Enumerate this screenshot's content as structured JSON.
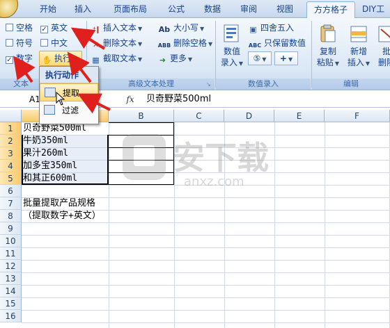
{
  "tabs": [
    "开始",
    "插入",
    "页面布局",
    "公式",
    "数据",
    "审阅",
    "视图",
    "方方格子",
    "DIY工"
  ],
  "active_tab": "方方格子",
  "ribbon": {
    "text_group": {
      "checkboxes": [
        {
          "label": "空格",
          "checked": false
        },
        {
          "label": "英文",
          "checked": true
        },
        {
          "label": "符号",
          "checked": false
        },
        {
          "label": "中文",
          "checked": false
        },
        {
          "label": "数字",
          "checked": true
        }
      ],
      "exec_label": "执行",
      "group_label": "文本"
    },
    "advanced_group": {
      "items": [
        "插入文本",
        "删除文本",
        "截取文本"
      ],
      "right_items": [
        "大小写",
        "删除空格",
        "更多"
      ],
      "group_label": "高级文本处理",
      "icons": {
        "caps": "Ab",
        "space": "ABB"
      }
    },
    "number_group": {
      "buttons": [
        "数值录入",
        "四舍五入",
        "只保留数值"
      ],
      "big_label_line1": "数值",
      "big_label_line2": "录入",
      "group_label": "数值录入",
      "plus": "+"
    },
    "edit_group": {
      "buttons": [
        {
          "line1": "复制",
          "line2": "粘贴"
        },
        {
          "line1": "新增",
          "line2": "插入"
        },
        {
          "line1": "批",
          "line2": "删除"
        }
      ],
      "group_label": "编辑"
    }
  },
  "dropdown": {
    "header": "执行动作",
    "items": [
      {
        "label": "提取",
        "highlighted": true
      },
      {
        "label": "过滤",
        "highlighted": false
      }
    ]
  },
  "formula_bar": {
    "name_box": "A1",
    "fx": "fx",
    "value": "贝奇野菜500ml"
  },
  "grid": {
    "columns": [
      "A",
      "B",
      "C",
      "D",
      "E",
      "F"
    ],
    "rows": [
      "1",
      "2",
      "3",
      "4",
      "5",
      "6",
      "7",
      "8",
      "9",
      "10",
      "11",
      "12",
      "13",
      "14",
      "15",
      "16"
    ],
    "cells": {
      "A1": "贝奇野菜500ml",
      "A2": "牛奶350ml",
      "A3": "果汁260ml",
      "A4": "加多宝350ml",
      "A5": "和其正600ml",
      "A7": "批量提取产品规格",
      "A8": "（提取数字+英文）"
    }
  },
  "watermark": {
    "text": "安下载",
    "sub": "anxz.com"
  },
  "colors": {
    "accent": "#15428b",
    "arrow": "#e0201c",
    "highlight": "#ffd978"
  }
}
